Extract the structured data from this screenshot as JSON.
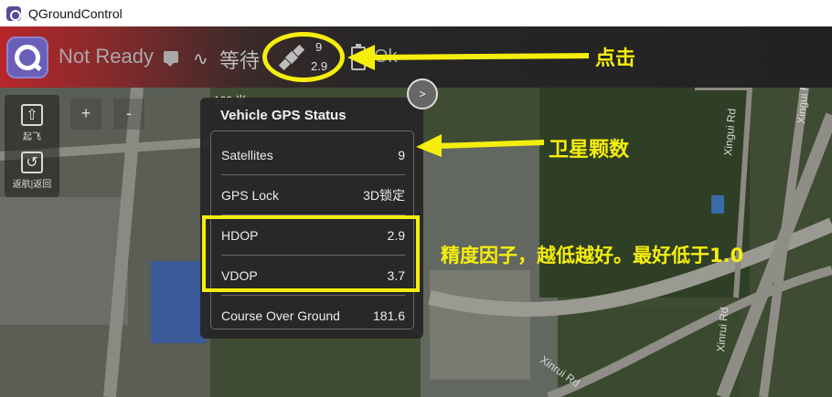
{
  "window": {
    "title": "QGroundControl"
  },
  "toolbar": {
    "status": "Not Ready",
    "mode": "等待",
    "gps_satellites": "9",
    "gps_hdop": "2.9",
    "battery": "Ok"
  },
  "map": {
    "scale": "100 米",
    "zoom_in": "+",
    "zoom_out": "-",
    "expand": ">",
    "tools": [
      {
        "label": "起飞",
        "icon": "takeoff-icon"
      },
      {
        "label": "返航|返回",
        "icon": "return-icon"
      }
    ],
    "road_labels": [
      "Xingui Rd",
      "Xinrui Rd",
      "Xingui Rd",
      "Xinrui Rd"
    ]
  },
  "gps_panel": {
    "title": "Vehicle GPS Status",
    "rows": [
      {
        "label": "Satellites",
        "value": "9"
      },
      {
        "label": "GPS Lock",
        "value": "3D锁定"
      },
      {
        "label": "HDOP",
        "value": "2.9"
      },
      {
        "label": "VDOP",
        "value": "3.7"
      },
      {
        "label": "Course Over Ground",
        "value": "181.6"
      }
    ]
  },
  "annotations": {
    "click": "点击",
    "satellites": "卫星颗数",
    "dop": "精度因子，越低越好。最好低于1.0"
  },
  "colors": {
    "annotation": "#f5ee0c",
    "toolbar_alert": "#b8262a"
  }
}
